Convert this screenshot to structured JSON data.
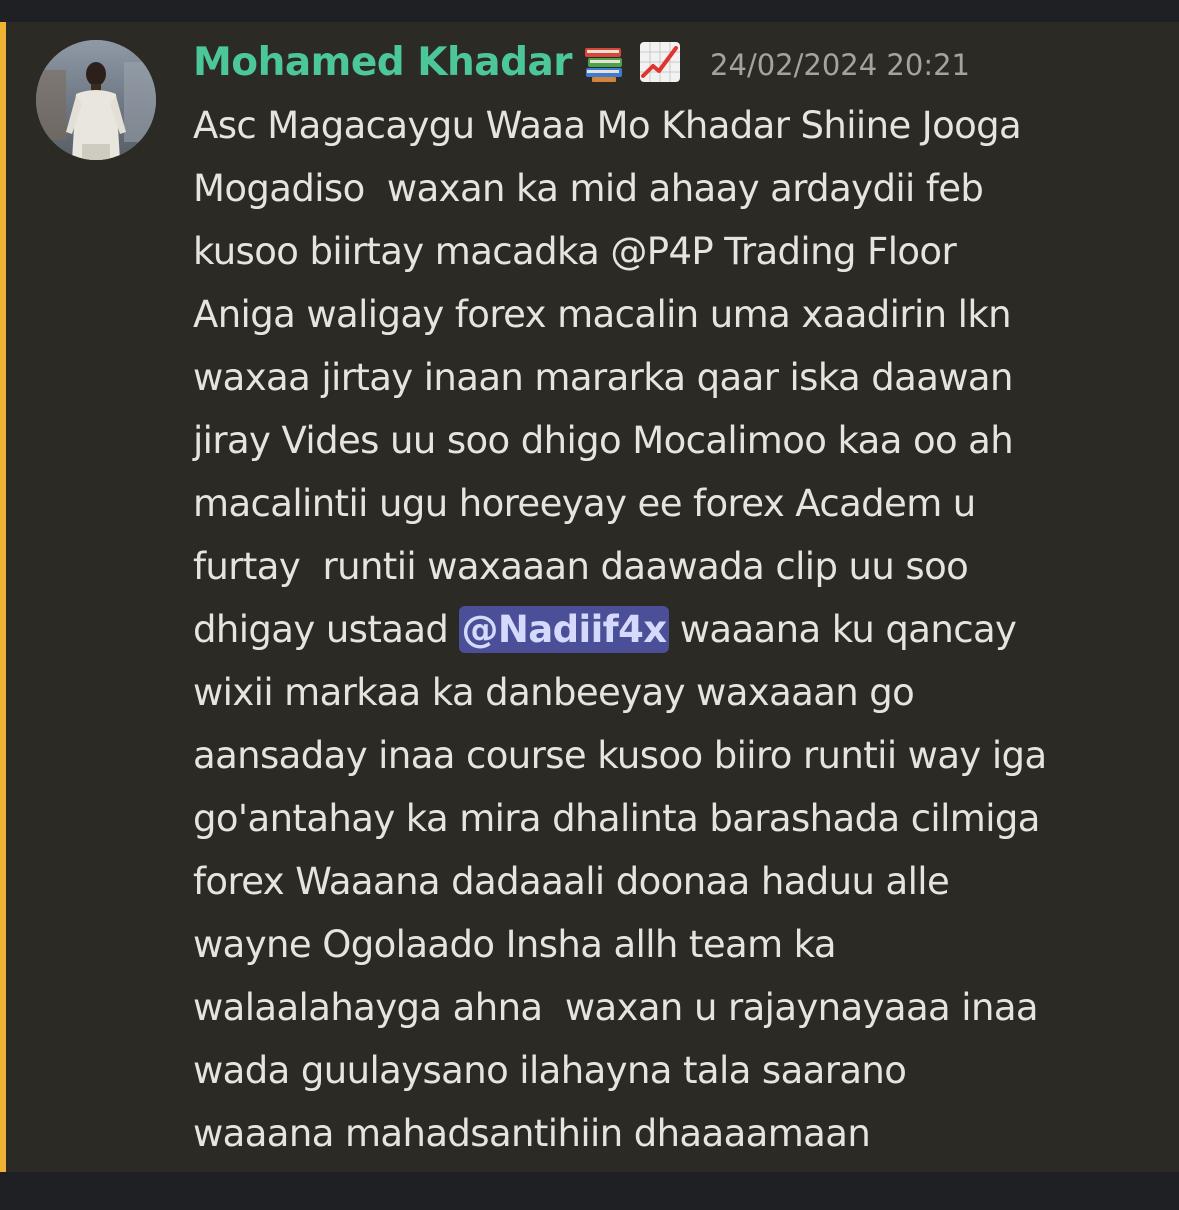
{
  "colors": {
    "username": "#4cc79c",
    "highlight_bar": "#f0b232",
    "mention_bg": "#4a4f98",
    "mention_text": "#d5dafc"
  },
  "message": {
    "author": "Mohamed Khadar",
    "author_badges": [
      "books-icon",
      "chart-increasing-icon"
    ],
    "timestamp": "24/02/2024 20:21",
    "lines": [
      {
        "text": "Asc Magacaygu Waaa Mo Khadar Shiine Jooga"
      },
      {
        "text": "Mogadiso  waxan ka mid ahaay ardaydii feb"
      },
      {
        "text": "kusoo biirtay macadka @P4P Trading Floor"
      },
      {
        "text": "Aniga waligay forex macalin uma xaadirin lkn"
      },
      {
        "text": "waxaa jirtay inaan mararka qaar iska daawan"
      },
      {
        "text": "jiray Vides uu soo dhigo Mocalimoo kaa oo ah"
      },
      {
        "text": "macalintii ugu horeeyay ee forex Academ u"
      },
      {
        "text": "furtay  runtii waxaaan daawada clip uu soo"
      },
      {
        "before": "dhigay ustaad ",
        "mention": "@Nadiif4x",
        "after": " waaana ku qancay"
      },
      {
        "text": "wixii markaa ka danbeeyay waxaaan go"
      },
      {
        "text": "aansaday inaa course kusoo biiro runtii way iga"
      },
      {
        "text": "go'antahay ka mira dhalinta barashada cilmiga"
      },
      {
        "text": "forex Waaana dadaaali doonaa haduu alle"
      },
      {
        "text": "wayne Ogolaado Insha allh team ka"
      },
      {
        "text": "walaalahayga ahna  waxan u rajaynayaaa inaa"
      },
      {
        "text": "wada guulaysano ilahayna tala saarano"
      },
      {
        "text": "waaana mahadsantihiin dhaaaamaan"
      }
    ]
  }
}
